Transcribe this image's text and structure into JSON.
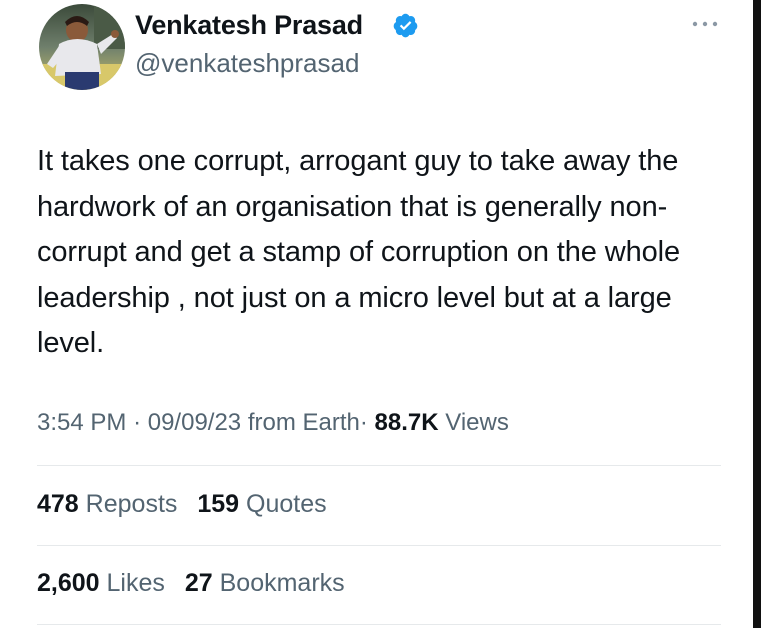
{
  "tweet": {
    "author": {
      "display_name": "Venkatesh Prasad",
      "handle": "@venkateshprasad",
      "verified": true
    },
    "text": "It takes one corrupt, arrogant guy to take away the hardwork of an organisation that is generally non-corrupt and get a stamp of corruption on the whole leadership , not just on a micro level but at a large level.",
    "meta": {
      "time": "3:54 PM",
      "separator": "·",
      "date": "09/09/23",
      "source": "from Earth",
      "views_count": "88.7K",
      "views_label": "Views"
    },
    "stats": {
      "reposts_count": "478",
      "reposts_label": "Reposts",
      "quotes_count": "159",
      "quotes_label": "Quotes",
      "likes_count": "2,600",
      "likes_label": "Likes",
      "bookmarks_count": "27",
      "bookmarks_label": "Bookmarks"
    }
  },
  "icons": {
    "verified": "verified-badge-icon",
    "more": "more-dots-icon"
  },
  "colors": {
    "text_primary": "#0f1419",
    "text_secondary": "#536471",
    "verified_blue": "#1d9bf0",
    "divider": "#e6e9eb"
  }
}
